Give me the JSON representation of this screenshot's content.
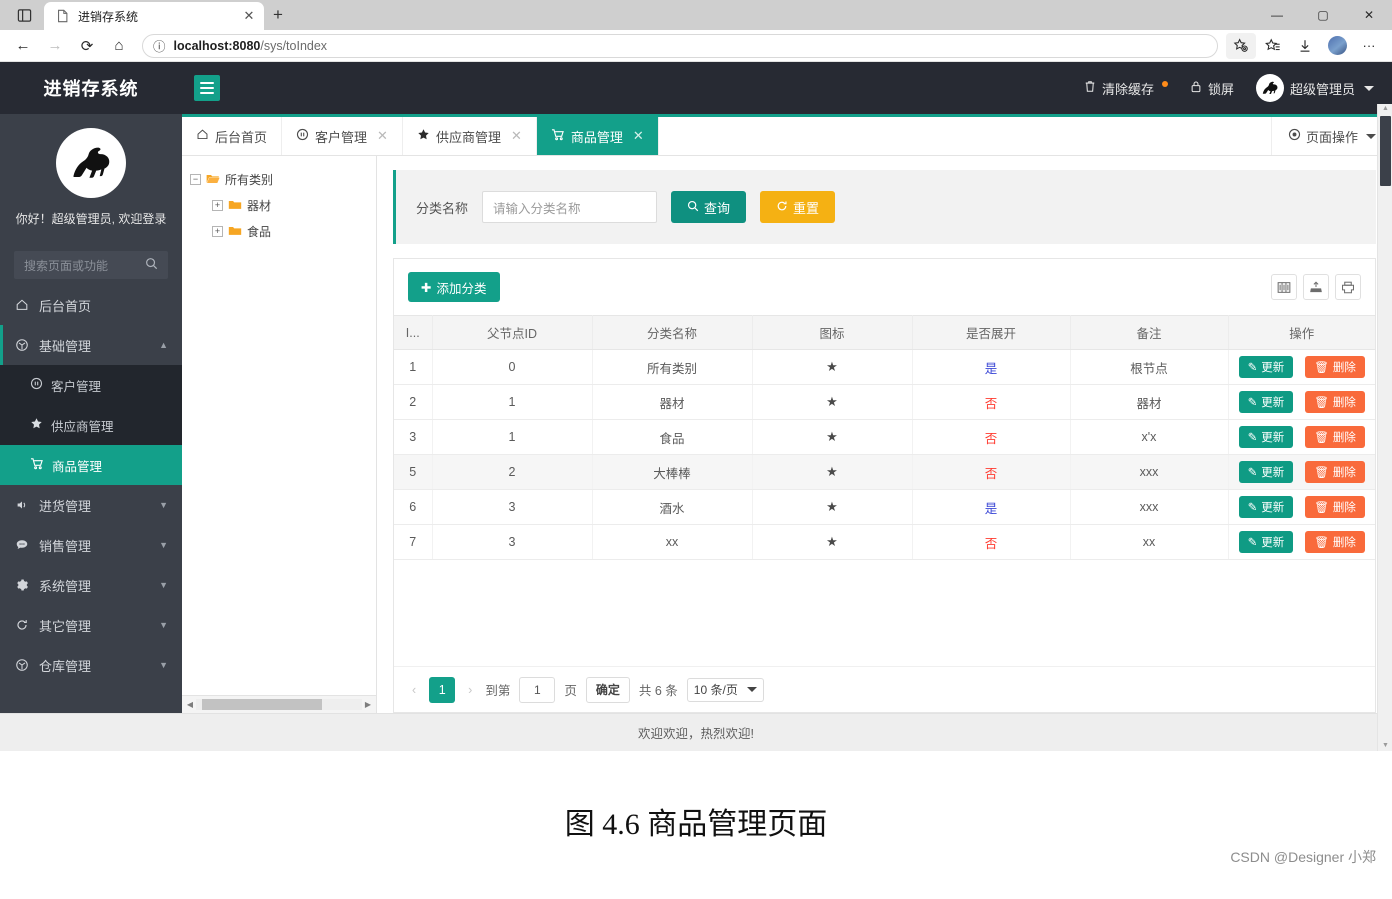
{
  "browser": {
    "tab": {
      "title": "进销存系统",
      "close_label": "✕",
      "favicon": "page-icon"
    },
    "new_tab_label": "+",
    "window_buttons": {
      "minimize": "—",
      "maximize": "▢",
      "close": "✕"
    },
    "nav": {
      "back": "←",
      "forward": "→",
      "reload": "⟳",
      "home": "⌂"
    },
    "address": {
      "info_icon": "ⓘ",
      "host": "localhost:8080",
      "path": "/sys/toIndex"
    },
    "toolbar_icons": [
      "favorite-star-icon",
      "collections-icon",
      "downloads-icon",
      "profile-avatar",
      "more-icon"
    ],
    "more_label": "···"
  },
  "header": {
    "brand": "进销存系统",
    "menu_toggle": "hamburger-icon",
    "clear_cache": "清除缓存",
    "lock_screen": "锁屏",
    "user": "超级管理员"
  },
  "sidebar": {
    "greeting": "你好！超级管理员, 欢迎登录",
    "search_placeholder": "搜索页面或功能",
    "items": [
      {
        "label": "后台首页",
        "icon": "home-icon",
        "arrow": ""
      },
      {
        "label": "基础管理",
        "icon": "cube-icon",
        "arrow": "▲"
      },
      {
        "label": "进货管理",
        "icon": "volume-icon",
        "arrow": "▼"
      },
      {
        "label": "销售管理",
        "icon": "chat-icon",
        "arrow": "▼"
      },
      {
        "label": "系统管理",
        "icon": "gear-icon",
        "arrow": "▼"
      },
      {
        "label": "其它管理",
        "icon": "refresh-icon",
        "arrow": "▼"
      },
      {
        "label": "仓库管理",
        "icon": "cube-icon",
        "arrow": "▼"
      }
    ],
    "submenu": [
      {
        "label": "客户管理",
        "icon": "pause-circle-icon"
      },
      {
        "label": "供应商管理",
        "icon": "star-icon"
      },
      {
        "label": "商品管理",
        "icon": "cart-icon"
      }
    ]
  },
  "tabs": [
    {
      "label": "后台首页",
      "icon": "home-icon",
      "closable": false,
      "active": false
    },
    {
      "label": "客户管理",
      "icon": "pause-circle-icon",
      "closable": true,
      "active": false
    },
    {
      "label": "供应商管理",
      "icon": "star-icon",
      "closable": true,
      "active": false
    },
    {
      "label": "商品管理",
      "icon": "cart-icon",
      "closable": true,
      "active": true
    }
  ],
  "tab_close_label": "✕",
  "page_action": "页面操作",
  "tree": [
    {
      "label": "所有类别",
      "toggle": "−",
      "level": 1,
      "open": true
    },
    {
      "label": "器材",
      "toggle": "+",
      "level": 2,
      "open": false
    },
    {
      "label": "食品",
      "toggle": "+",
      "level": 2,
      "open": false
    }
  ],
  "search_form": {
    "label": "分类名称",
    "placeholder": "请输入分类名称",
    "submit": "查询",
    "reset": "重置"
  },
  "table_toolbar": {
    "add": "添加分类",
    "icons": [
      "columns-icon",
      "export-icon",
      "print-icon"
    ]
  },
  "table": {
    "columns": [
      "I...",
      "父节点ID",
      "分类名称",
      "图标",
      "是否展开",
      "备注",
      "操作"
    ],
    "rows": [
      {
        "id": "1",
        "parent": "0",
        "name": "所有类别",
        "icon": "★",
        "expand": "是",
        "expand_flag": "yes",
        "remark": "根节点"
      },
      {
        "id": "2",
        "parent": "1",
        "name": "器材",
        "icon": "★",
        "expand": "否",
        "expand_flag": "no",
        "remark": "器材"
      },
      {
        "id": "3",
        "parent": "1",
        "name": "食品",
        "icon": "★",
        "expand": "否",
        "expand_flag": "no",
        "remark": "x'x"
      },
      {
        "id": "5",
        "parent": "2",
        "name": "大棒棒",
        "icon": "★",
        "expand": "否",
        "expand_flag": "no",
        "remark": "xxx"
      },
      {
        "id": "6",
        "parent": "3",
        "name": "酒水",
        "icon": "★",
        "expand": "是",
        "expand_flag": "yes",
        "remark": "xxx"
      },
      {
        "id": "7",
        "parent": "3",
        "name": "xx",
        "icon": "★",
        "expand": "否",
        "expand_flag": "no",
        "remark": "xx"
      }
    ],
    "row_actions": {
      "update": "更新",
      "delete": "删除"
    }
  },
  "pagination": {
    "prev": "‹",
    "next": "›",
    "current_page": "1",
    "goto_prefix": "到第",
    "goto_value": "1",
    "goto_suffix": "页",
    "confirm": "确定",
    "total": "共 6 条",
    "page_size": "10 条/页"
  },
  "footer": "欢迎欢迎，热烈欢迎!",
  "caption": "图 4.6 商品管理页面",
  "watermark": "CSDN @Designer 小郑",
  "colors": {
    "brand_teal": "#13a08a",
    "sidebar_dark": "#3b4049",
    "header_dark": "#272a33",
    "amber": "#f5b113",
    "danger": "#f96a3b",
    "yes_blue": "#3b47d6",
    "no_red": "#ff3b30"
  }
}
